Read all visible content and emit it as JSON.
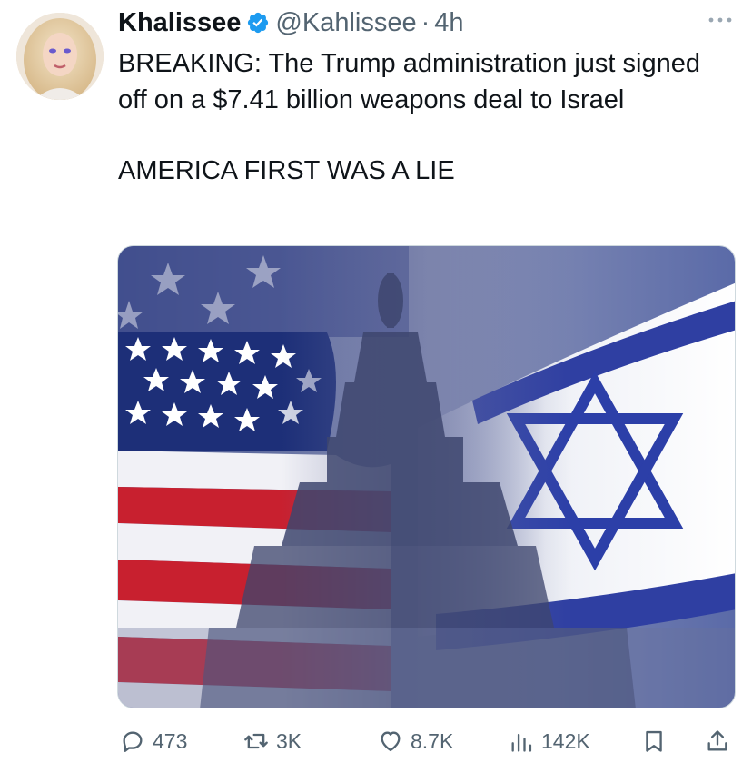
{
  "tweet": {
    "author_name": "Khalissee",
    "handle": "@Kahlissee",
    "separator": "·",
    "time": "4h",
    "verified": true,
    "text_lines": [
      "BREAKING: The Trump administration just signed off on a $7.41 billion weapons deal to Israel",
      "AMERICA FIRST WAS A LIE"
    ]
  },
  "actions": {
    "replies": "473",
    "reposts": "3K",
    "likes": "8.7K",
    "views": "142K"
  },
  "colors": {
    "verified_blue": "#1d9bf0",
    "secondary_text": "#536471",
    "primary_text": "#0f1419"
  },
  "icons": {
    "more": "more-horizontal-icon",
    "reply": "reply-icon",
    "repost": "retweet-icon",
    "like": "heart-icon",
    "views": "views-chart-icon",
    "bookmark": "bookmark-icon",
    "share": "share-icon"
  }
}
